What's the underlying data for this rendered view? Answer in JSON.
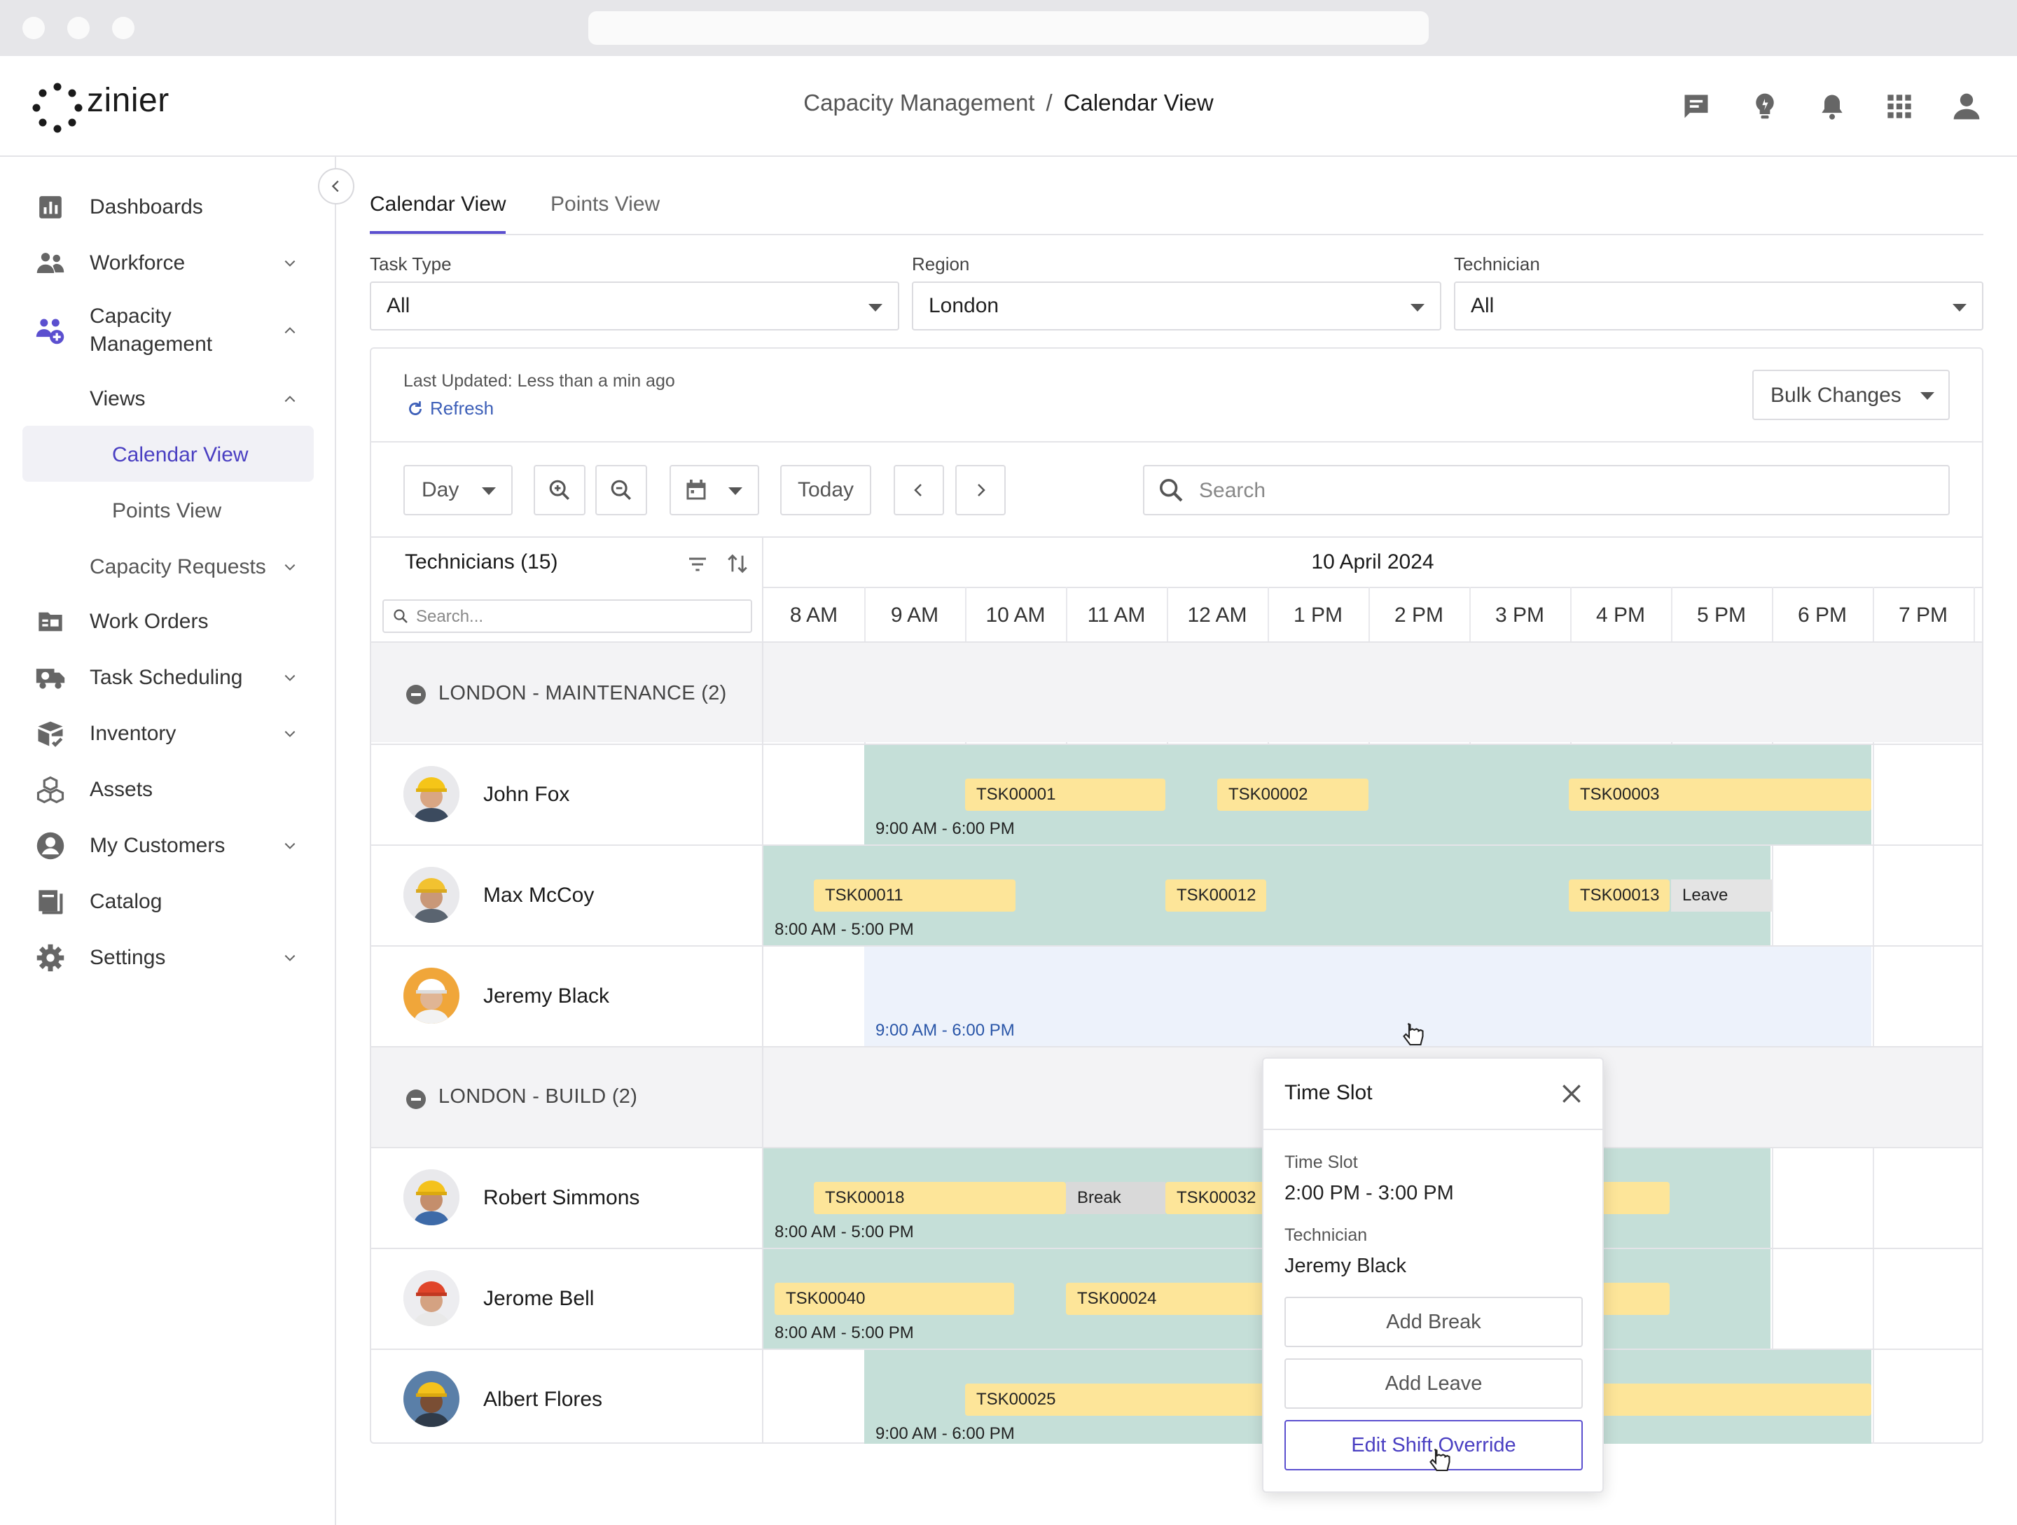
{
  "header": {
    "logo_text": "zinier",
    "breadcrumb_parent": "Capacity Management",
    "breadcrumb_sep": "/",
    "breadcrumb_current": "Calendar View",
    "icons": [
      "chat-icon",
      "lightbulb-icon",
      "bell-icon",
      "apps-grid-icon",
      "user-icon"
    ]
  },
  "sidebar": {
    "items": [
      {
        "label": "Dashboards",
        "icon": "bar-chart-icon"
      },
      {
        "label": "Workforce",
        "icon": "people-icon"
      },
      {
        "label": "Capacity",
        "label2": "Management",
        "icon": "capacity-icon"
      },
      {
        "label": "Views"
      },
      {
        "label": "Calendar View"
      },
      {
        "label": "Points View"
      },
      {
        "label": "Capacity Requests"
      },
      {
        "label": "Work Orders",
        "icon": "folder-icon"
      },
      {
        "label": "Task Scheduling",
        "icon": "truck-icon"
      },
      {
        "label": "Inventory",
        "icon": "inventory-icon"
      },
      {
        "label": "Assets",
        "icon": "cubes-icon"
      },
      {
        "label": "My Customers",
        "icon": "customer-icon"
      },
      {
        "label": "Catalog",
        "icon": "book-icon"
      },
      {
        "label": "Settings",
        "icon": "gear-icon"
      }
    ]
  },
  "tabs": [
    {
      "label": "Calendar View",
      "active": true
    },
    {
      "label": "Points View",
      "active": false
    }
  ],
  "filters": {
    "task_type": {
      "label": "Task Type",
      "value": "All"
    },
    "region": {
      "label": "Region",
      "value": "London"
    },
    "technician": {
      "label": "Technician",
      "value": "All"
    }
  },
  "status": {
    "last_updated": "Last Updated: Less than a min ago",
    "refresh": "Refresh",
    "bulk_changes": "Bulk Changes"
  },
  "toolbar": {
    "view": "Day",
    "today": "Today",
    "search_placeholder": "Search"
  },
  "grid": {
    "technicians_header": "Technicians (15)",
    "date": "10 April 2024",
    "tech_search_placeholder": "Search...",
    "hours": [
      "8 AM",
      "9 AM",
      "10 AM",
      "11 AM",
      "12 AM",
      "1 PM",
      "2 PM",
      "3 PM",
      "4 PM",
      "5 PM",
      "6 PM",
      "7 PM"
    ],
    "groups": [
      {
        "label": "LONDON - MAINTENANCE (2)"
      },
      {
        "label": "LONDON - BUILD (2)"
      }
    ],
    "technicians": [
      {
        "name": "John Fox",
        "shift": "9:00 AM - 6:00 PM",
        "tasks": [
          "TSK00001",
          "TSK00002",
          "TSK00003"
        ]
      },
      {
        "name": "Max McCoy",
        "shift": "8:00 AM - 5:00 PM",
        "tasks": [
          "TSK00011",
          "TSK00012",
          "TSK00013"
        ],
        "leave": "Leave"
      },
      {
        "name": "Jeremy Black",
        "shift": "9:00 AM - 6:00 PM",
        "tasks": []
      },
      {
        "name": "Robert Simmons",
        "shift": "8:00 AM - 5:00 PM",
        "tasks": [
          "TSK00018",
          "TSK00032"
        ],
        "break": "Break"
      },
      {
        "name": "Jerome Bell",
        "shift": "8:00 AM - 5:00 PM",
        "tasks": [
          "TSK00040",
          "TSK00024"
        ]
      },
      {
        "name": "Albert Flores",
        "shift": "9:00 AM - 6:00 PM",
        "tasks": [
          "TSK00025"
        ]
      }
    ]
  },
  "popup": {
    "title": "Time Slot",
    "slot_label": "Time Slot",
    "slot_value": "2:00 PM - 3:00 PM",
    "tech_label": "Technician",
    "tech_value": "Jeremy Black",
    "add_break": "Add Break",
    "add_leave": "Add Leave",
    "edit_shift": "Edit Shift Override"
  },
  "colors": {
    "accent": "#5b4fcf",
    "shift": "#c5dfd8",
    "task": "#fde599",
    "selected_shift": "#edf2fb"
  }
}
